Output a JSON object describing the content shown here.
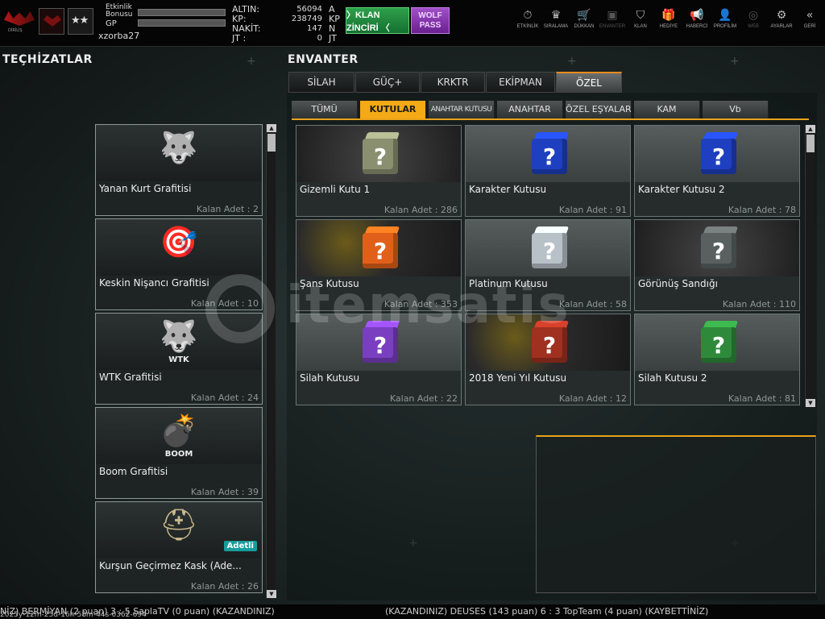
{
  "topbar": {
    "etkinlik_bonusu_label": "Etkinlik\nBonusu",
    "gp_label": "GP",
    "username": "xzorba27",
    "rank_stars": "★★",
    "currencies": [
      {
        "label": "ALTIN",
        "value": "56094",
        "unit": "A"
      },
      {
        "label": "KP",
        "value": "238749",
        "unit": "KP"
      },
      {
        "label": "NAKİT",
        "value": "147",
        "unit": "N"
      },
      {
        "label": "JT",
        "value": "0",
        "unit": "JT"
      }
    ],
    "klan_button": "〉KLAN ZİNCİRİ 〈",
    "wolf_pass_line1": "WOLF",
    "wolf_pass_line2": "PASS",
    "logo_sub": "DİRİLİŞ",
    "nav": [
      {
        "label": "ETKİNLİK",
        "icon": "stopwatch-icon",
        "glyph": "⏱",
        "dim": false
      },
      {
        "label": "SIRALAMA",
        "icon": "rank-icon",
        "glyph": "♛",
        "dim": false
      },
      {
        "label": "DÜKKAN",
        "icon": "cart-icon",
        "glyph": "🛒",
        "dim": false
      },
      {
        "label": "ENVANTER",
        "icon": "inventory-icon",
        "glyph": "▣",
        "dim": true
      },
      {
        "label": "KLAN",
        "icon": "shield-icon",
        "glyph": "⛉",
        "dim": false
      },
      {
        "label": "HEDİYE",
        "icon": "gift-icon",
        "glyph": "🎁",
        "dim": false
      },
      {
        "label": "HABERCİ",
        "icon": "megaphone-icon",
        "glyph": "📢",
        "dim": false
      },
      {
        "label": "PROFİLİM",
        "icon": "profile-icon",
        "glyph": "👤",
        "dim": false
      },
      {
        "label": "WEB",
        "icon": "globe-icon",
        "glyph": "◎",
        "dim": true
      },
      {
        "label": "AYARLAR",
        "icon": "gear-icon",
        "glyph": "⚙",
        "dim": false
      },
      {
        "label": "GERİ",
        "icon": "back-icon",
        "glyph": "«",
        "dim": false
      }
    ]
  },
  "left": {
    "title": "TEÇHİZATLAR",
    "items": [
      {
        "name": "Yanan Kurt Grafitisi",
        "count": "Kalan Adet : 2",
        "icon": "wolf-flame-graffiti",
        "glyph": "🐺",
        "color": "#c0392b"
      },
      {
        "name": "Keskin Nişancı Grafitisi",
        "count": "Kalan Adet : 10",
        "icon": "sniper-graffiti",
        "glyph": "🎯",
        "color": "#8b6a4a"
      },
      {
        "name": "WTK Grafitisi",
        "count": "Kalan Adet : 24",
        "icon": "wtk-wolf-graffiti",
        "glyph": "🐺",
        "color": "#ffffff",
        "sub": "WTK"
      },
      {
        "name": "Boom Grafitisi",
        "count": "Kalan Adet : 39",
        "icon": "boom-graffiti",
        "glyph": "💣",
        "color": "#d35400",
        "sub": "BOOM"
      },
      {
        "name": "Kurşun Geçirmez Kask (Ade...",
        "count": "Kalan Adet : 26",
        "icon": "helmet",
        "glyph": "⛑",
        "color": "#c8b88a",
        "badge": "Adetli"
      }
    ]
  },
  "inventory": {
    "title": "ENVANTER",
    "tabs": [
      {
        "label": "SİLAH",
        "active": false
      },
      {
        "label": "GÜÇ+",
        "active": false
      },
      {
        "label": "KRKTR",
        "active": false
      },
      {
        "label": "EKİPMAN",
        "active": false
      },
      {
        "label": "ÖZEL",
        "active": true
      }
    ],
    "subtabs": [
      {
        "label": "TÜMÜ",
        "active": false
      },
      {
        "label": "KUTULAR",
        "active": true
      },
      {
        "label": "ANAHTAR KUTUSU",
        "active": false
      },
      {
        "label": "ANAHTAR",
        "active": false
      },
      {
        "label": "ÖZEL EŞYALAR",
        "active": false
      },
      {
        "label": "KAM",
        "active": false
      },
      {
        "label": "Vb",
        "active": false
      }
    ],
    "items": [
      {
        "name": "Gizemli Kutu 1",
        "count": "Kalan Adet : 286",
        "icon": "mystery-box-icon",
        "color": "#8a8f70",
        "bg": "bg-dark"
      },
      {
        "name": "Karakter Kutusu",
        "count": "Kalan Adet : 91",
        "icon": "blue-box-icon",
        "color": "#1e3fbf",
        "bg": "bg-gray"
      },
      {
        "name": "Karakter Kutusu 2",
        "count": "Kalan Adet : 78",
        "icon": "blue-box-icon",
        "color": "#1e3fbf",
        "bg": "bg-gray"
      },
      {
        "name": "Şans Kutusu",
        "count": "Kalan Adet : 353",
        "icon": "orange-box-icon",
        "color": "#e0601a",
        "bg": "bg-fire"
      },
      {
        "name": "Platinum Kutusu",
        "count": "Kalan Adet : 58",
        "icon": "silver-box-icon",
        "color": "#b8c0c8",
        "bg": "bg-gray"
      },
      {
        "name": "Görünüş Sandığı",
        "count": "Kalan Adet : 110",
        "icon": "chest-icon",
        "color": "#5a6060",
        "bg": "bg-dark"
      },
      {
        "name": "Silah Kutusu",
        "count": "Kalan Adet : 22",
        "icon": "purple-box-icon",
        "color": "#7a3fc0",
        "bg": "bg-gray"
      },
      {
        "name": "2018 Yeni Yıl Kutusu",
        "count": "Kalan Adet : 12",
        "icon": "gift-box-icon",
        "color": "#a03020",
        "bg": "bg-fire"
      },
      {
        "name": "Silah Kutusu 2",
        "count": "Kalan Adet : 81",
        "icon": "green-box-icon",
        "color": "#2e8a3a",
        "bg": "bg-gray"
      }
    ]
  },
  "ticker": {
    "left": "NİZ) BERMİYAN (2 puan) 3 : 5 SaplaTV (0 puan) (KAZANDINIZ)",
    "right": "(KAZANDINIZ) DEUSES (143 puan) 6 : 3 TopTeam (4 puan) (KAYBETTİNİZ)",
    "timestamp": "2025y-12m-25d-16h-58m-44s-0362-694"
  },
  "watermark": "itemsatis"
}
